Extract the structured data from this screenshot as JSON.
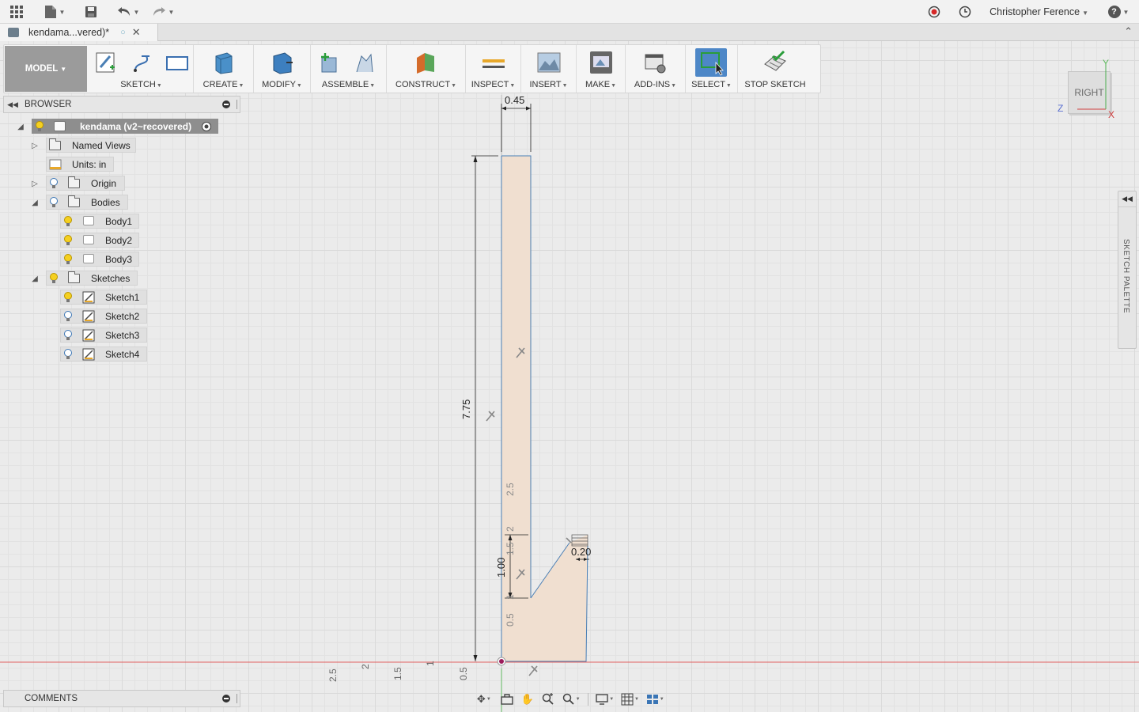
{
  "titlebar": {
    "user_name": "Christopher Ference",
    "help_label": "?"
  },
  "tab": {
    "title": "kendama...vered)*"
  },
  "toolbar": {
    "workspace_label": "MODEL",
    "groups": [
      {
        "label": "SKETCH"
      },
      {
        "label": "CREATE"
      },
      {
        "label": "MODIFY"
      },
      {
        "label": "ASSEMBLE"
      },
      {
        "label": "CONSTRUCT"
      },
      {
        "label": "INSPECT"
      },
      {
        "label": "INSERT"
      },
      {
        "label": "MAKE"
      },
      {
        "label": "ADD-INS"
      },
      {
        "label": "SELECT"
      },
      {
        "label": "STOP SKETCH"
      }
    ]
  },
  "browser": {
    "title": "BROWSER",
    "root": "kendama (v2~recovered)",
    "named_views": "Named Views",
    "units": "Units: in",
    "origin": "Origin",
    "bodies": "Bodies",
    "body_items": [
      "Body1",
      "Body2",
      "Body3"
    ],
    "sketches": "Sketches",
    "sketch_items": [
      "Sketch1",
      "Sketch2",
      "Sketch3",
      "Sketch4"
    ]
  },
  "comments": {
    "title": "COMMENTS"
  },
  "viewcube": {
    "face": "RIGHT",
    "axis_y": "Y",
    "axis_z": "Z",
    "axis_x": "X"
  },
  "sketch_palette": {
    "label": "SKETCH PALETTE"
  },
  "sketch": {
    "dim_width_top": "0.45",
    "dim_height_total": "7.75",
    "dim_notch_height": "1.00",
    "dim_tip_width": "0.20",
    "ruler_vertical": [
      "2.5",
      "2",
      "1.5",
      "1",
      "0.5"
    ],
    "ruler_horizontal": [
      "2.5",
      "2",
      "1.5",
      "1",
      "0.5"
    ]
  },
  "colors": {
    "accent_blue": "#4a7fb5",
    "sketch_fill": "#f0dfd0",
    "axis_red": "#e06060",
    "axis_green": "#6ac26a"
  }
}
